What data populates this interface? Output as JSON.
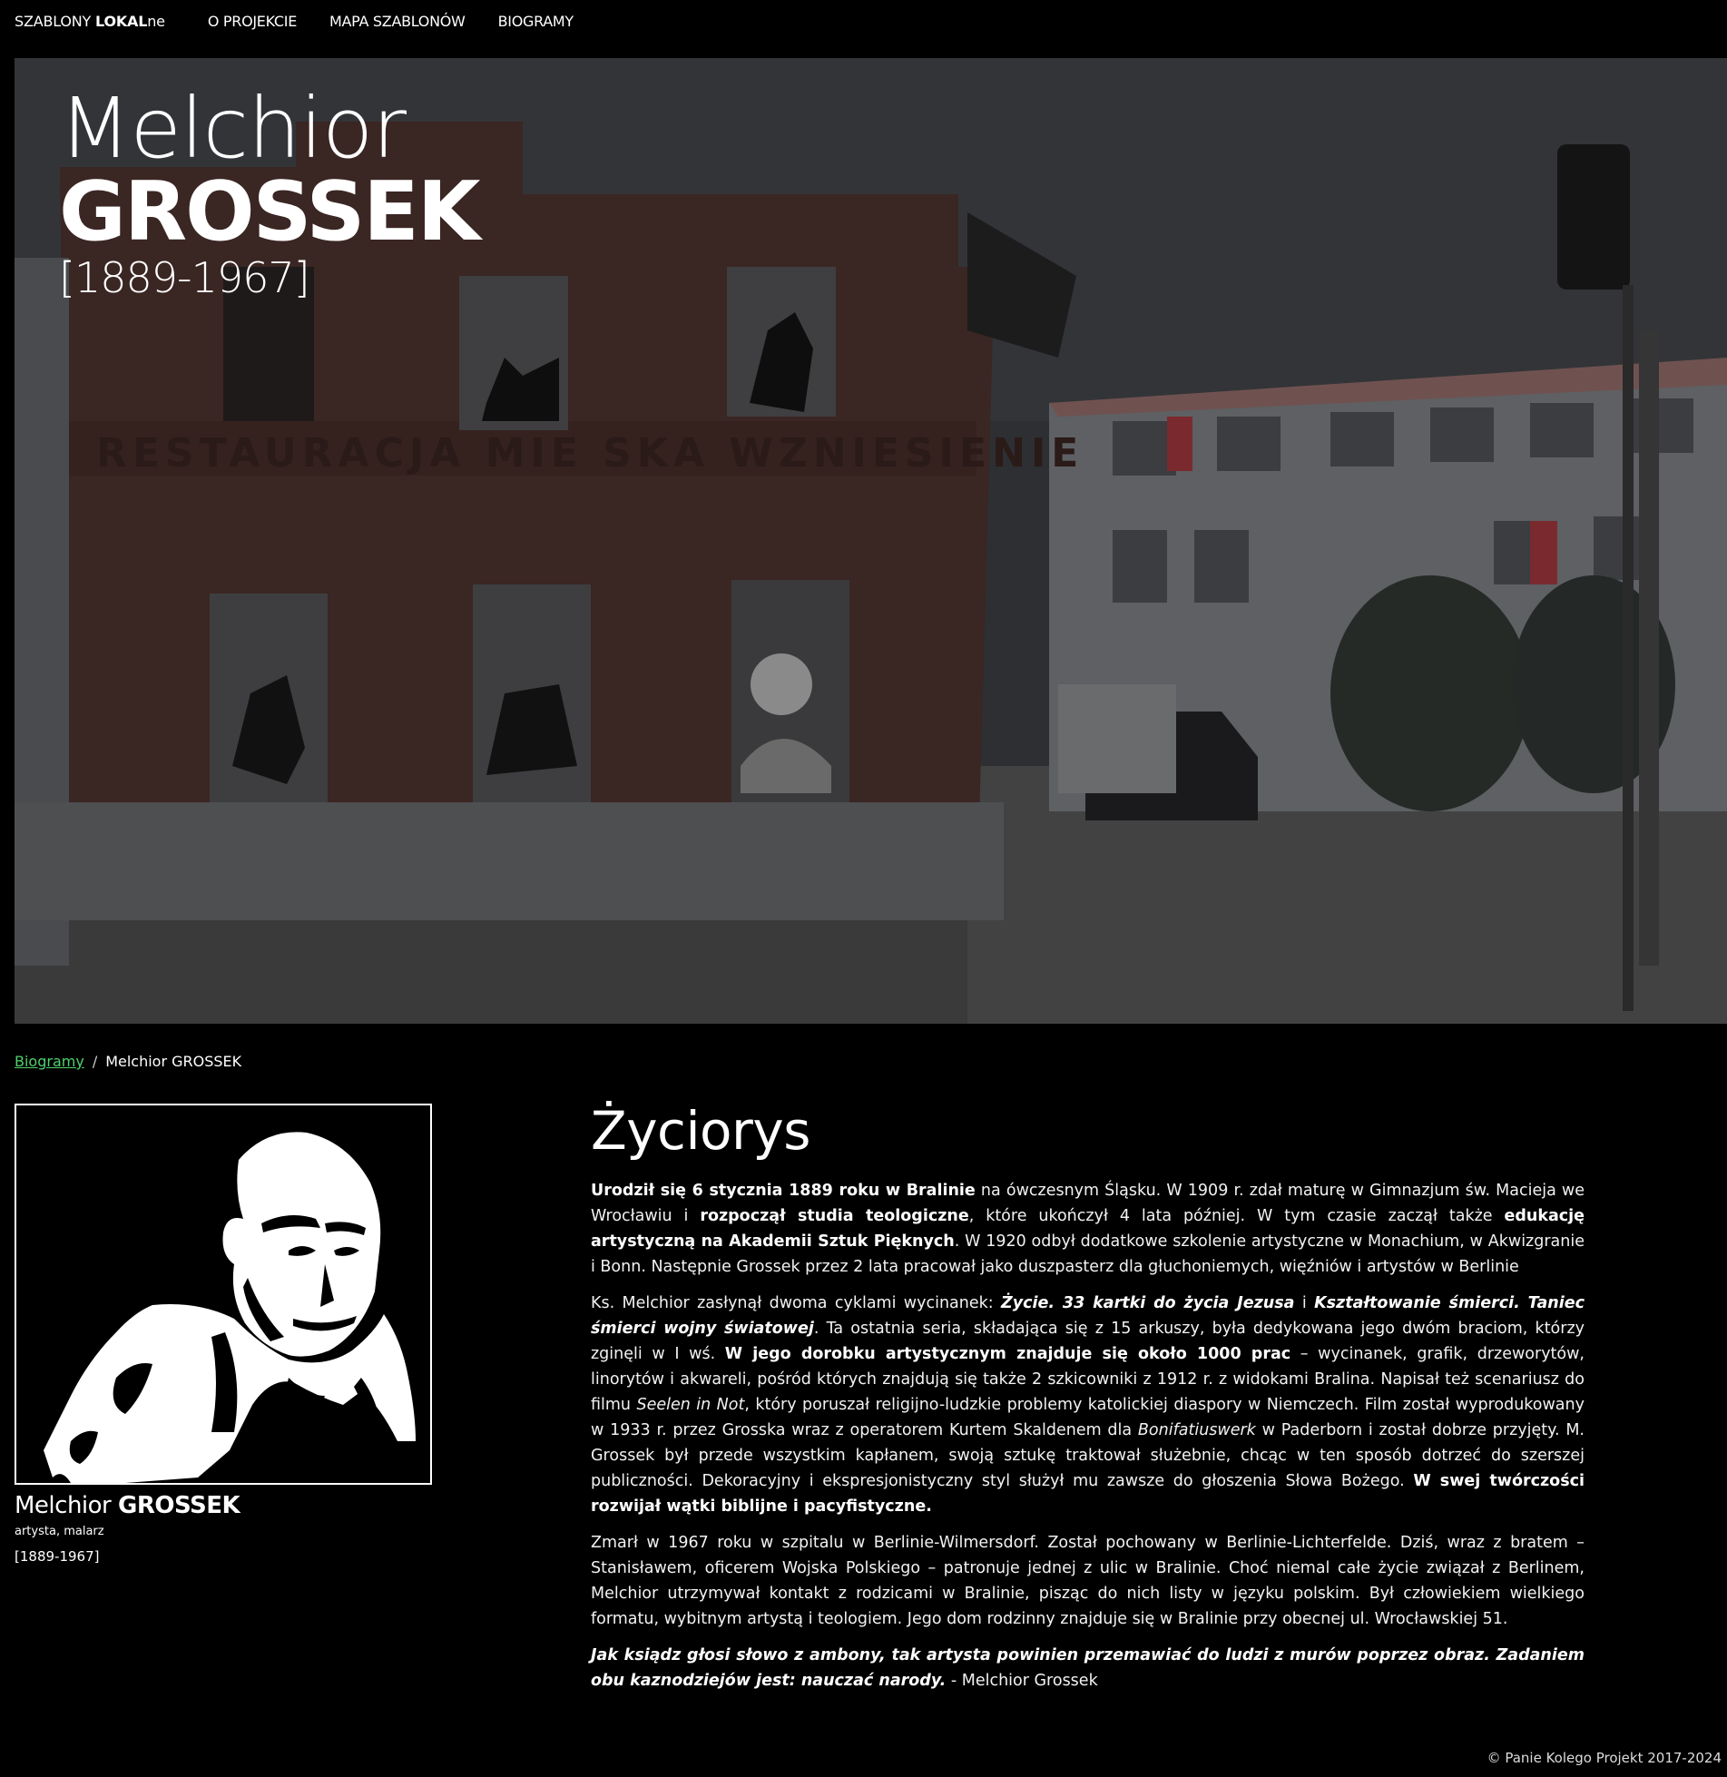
{
  "nav": {
    "brand_prefix": "SZABLONY ",
    "brand_bold": "LOKAL",
    "brand_suffix": "ne",
    "links": [
      "O PROJEKCIE",
      "MAPA SZABLONÓW",
      "BIOGRAMY"
    ]
  },
  "hero": {
    "first_name": "Melchior",
    "last_name": "GROSSEK",
    "years": "[1889-1967]"
  },
  "breadcrumb": {
    "parent": "Biogramy",
    "separator": "/",
    "current": "Melchior GROSSEK"
  },
  "profile": {
    "first_name": "Melchior ",
    "last_name": "GROSSEK",
    "role": "artysta, malarz",
    "years": "[1889-1967]"
  },
  "bio": {
    "heading": "Życiorys",
    "p1": [
      {
        "t": "Urodził się 6 stycznia 1889 roku w Bralinie",
        "b": true
      },
      {
        "t": " na ówczesnym Śląsku. W 1909 r. zdał maturę w Gimnazjum św. Macieja we Wrocławiu i "
      },
      {
        "t": "rozpoczął studia teologiczne",
        "b": true
      },
      {
        "t": ", które ukończył 4 lata później. W tym czasie zaczął także "
      },
      {
        "t": "edukację artystyczną na Akademii Sztuk Pięknych",
        "b": true
      },
      {
        "t": ". W 1920 odbył dodatkowe szkolenie artystyczne w Monachium, w Akwizgranie i Bonn. Następnie Grossek przez 2 lata pracował jako duszpasterz dla głuchoniemych, więźniów i artystów w Berlinie"
      }
    ],
    "p2": [
      {
        "t": "Ks. Melchior zasłynął dwoma cyklami wycinanek: "
      },
      {
        "t": "Życie. 33 kartki do życia Jezusa",
        "b": true,
        "i": true
      },
      {
        "t": " i "
      },
      {
        "t": "Kształtowanie śmierci. Taniec śmierci wojny światowej",
        "b": true,
        "i": true
      },
      {
        "t": ". Ta ostatnia seria, składająca się z 15 arkuszy, była dedykowana jego dwóm braciom, którzy zginęli w I wś. "
      },
      {
        "t": "W jego dorobku artystycznym znajduje się około 1000 prac",
        "b": true
      },
      {
        "t": " – wycinanek, grafik, drzeworytów, linorytów i akwareli, pośród których znajdują się także 2 szkicowniki z 1912 r. z widokami Bralina. Napisał też scenariusz do filmu "
      },
      {
        "t": "Seelen in Not",
        "i": true
      },
      {
        "t": ", który poruszał religijno-ludzkie problemy katolickiej diaspory w Niemczech. Film został wyprodukowany w 1933 r. przez Grosska wraz z operatorem Kurtem Skaldenem dla "
      },
      {
        "t": "Bonifatiuswerk",
        "i": true
      },
      {
        "t": " w Paderborn i został dobrze przyjęty. M. Grossek był przede wszystkim kapłanem, swoją sztukę traktował służebnie, chcąc w ten sposób dotrzeć do szerszej publiczności. Dekoracyjny i ekspresjonistyczny styl służył mu zawsze do głoszenia Słowa Bożego. "
      },
      {
        "t": "W swej twórczości rozwijał wątki biblijne i pacyfistyczne.",
        "b": true
      }
    ],
    "p3": [
      {
        "t": "Zmarł w 1967 roku w szpitalu w Berlinie-Wilmersdorf. Został pochowany w Berlinie-Lichterfelde. Dziś, wraz z bratem – Stanisławem, oficerem Wojska Polskiego – patronuje jednej z ulic w Bralinie. Choć niemal całe życie związał z Berlinem, Melchior utrzymywał kontakt z rodzicami w Bralinie, pisząc do nich listy w języku polskim. Był człowiekiem wielkiego formatu, wybitnym artystą i teologiem. Jego dom rodzinny znajduje się w Bralinie przy obecnej ul. Wrocławskiej 51."
      }
    ],
    "p4": [
      {
        "t": "Jak ksiądz głosi słowo z ambony, tak artysta powinien przemawiać do ludzi z murów poprzez obraz. Zadaniem obu kaznodziejów jest: nauczać narody.",
        "b": true,
        "i": true
      },
      {
        "t": " - Melchior Grossek"
      }
    ]
  },
  "footer": "© Panie Kolego Projekt 2017-2024"
}
